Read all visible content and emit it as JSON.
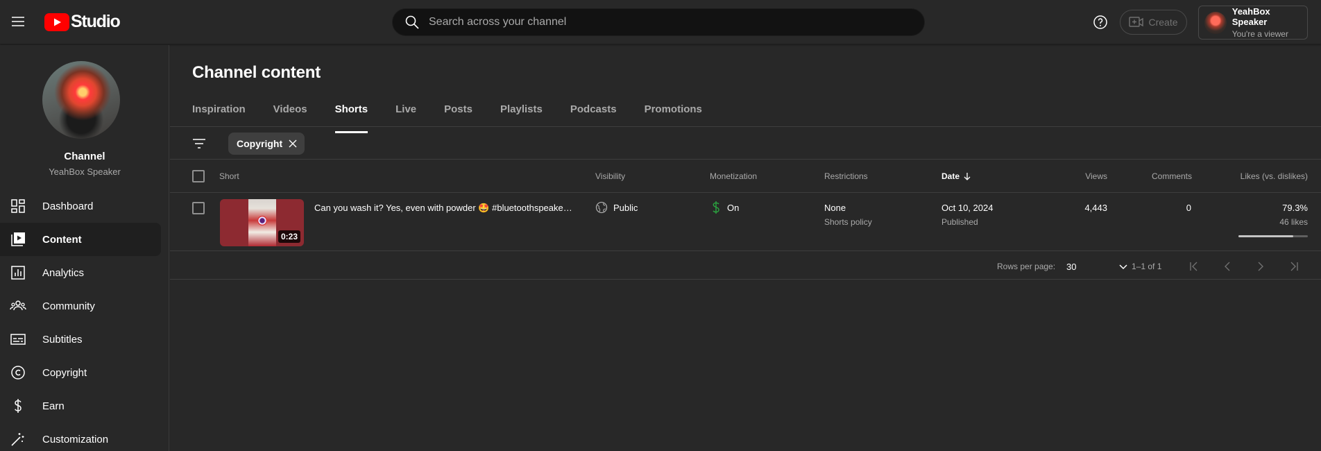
{
  "header": {
    "logo_text": "Studio",
    "search_placeholder": "Search across your channel",
    "create_label": "Create",
    "account_name": "YeahBox Speaker",
    "account_role": "You're a viewer"
  },
  "sidebar": {
    "channel_title": "Channel",
    "channel_name": "YeahBox Speaker",
    "items": [
      {
        "label": "Dashboard",
        "icon": "dashboard-icon"
      },
      {
        "label": "Content",
        "icon": "content-icon",
        "active": true
      },
      {
        "label": "Analytics",
        "icon": "analytics-icon"
      },
      {
        "label": "Community",
        "icon": "community-icon"
      },
      {
        "label": "Subtitles",
        "icon": "subtitles-icon"
      },
      {
        "label": "Copyright",
        "icon": "copyright-icon"
      },
      {
        "label": "Earn",
        "icon": "dollar-icon"
      },
      {
        "label": "Customization",
        "icon": "magic-wand-icon"
      }
    ]
  },
  "main": {
    "title": "Channel content",
    "tabs": [
      "Inspiration",
      "Videos",
      "Shorts",
      "Live",
      "Posts",
      "Playlists",
      "Podcasts",
      "Promotions"
    ],
    "active_tab": "Shorts",
    "filter_chip": "Copyright",
    "columns": {
      "short": "Short",
      "visibility": "Visibility",
      "monetization": "Monetization",
      "restrictions": "Restrictions",
      "date": "Date",
      "views": "Views",
      "comments": "Comments",
      "likes": "Likes (vs. dislikes)"
    },
    "rows": [
      {
        "title": "Can you wash it? Yes, even with powder 🤩 #bluetoothspeake…",
        "duration": "0:23",
        "visibility": "Public",
        "monetization": "On",
        "restriction": "None",
        "restriction_detail": "Shorts policy",
        "date": "Oct 10, 2024",
        "date_status": "Published",
        "views": "4,443",
        "comments": "0",
        "likes_pct": "79.3%",
        "likes_count": "46 likes",
        "likes_ratio": 0.793
      }
    ],
    "pager": {
      "rows_per_page_label": "Rows per page:",
      "rows_per_page": "30",
      "range": "1–1 of 1"
    }
  },
  "colors": {
    "background": "#282828",
    "brand_red": "#ff0000",
    "monetization_green": "#2ba640"
  }
}
